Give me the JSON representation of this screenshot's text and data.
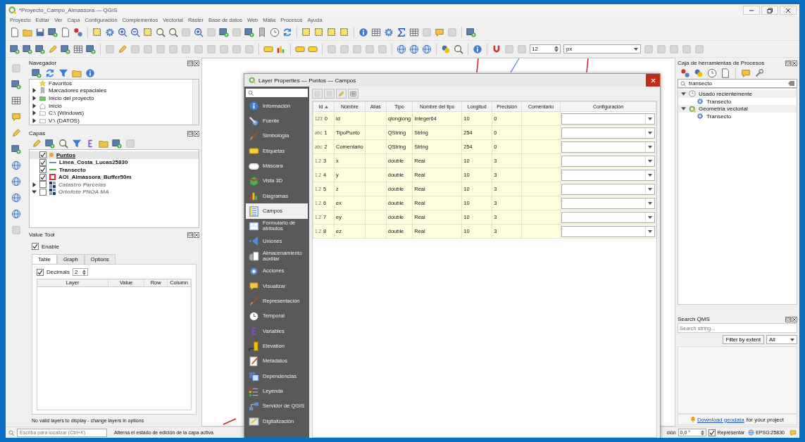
{
  "window": {
    "title": "*Proyecto_Campo_Almassora — QGIS"
  },
  "menu": [
    "Proyecto",
    "Editar",
    "Ver",
    "Capa",
    "Configuración",
    "Complementos",
    "Vectorial",
    "Ráster",
    "Base de datos",
    "Web",
    "Malla",
    "Procesos",
    "Ayuda"
  ],
  "style_toolbar": {
    "size": "12",
    "unit": "px"
  },
  "navigator": {
    "title": "Navegador",
    "items": [
      {
        "label": "Favoritos",
        "kind": "favorites"
      },
      {
        "label": "Marcadores espaciales",
        "kind": "bookmarks",
        "expanded": false
      },
      {
        "label": "Inicio del proyecto",
        "kind": "project",
        "expanded": false
      },
      {
        "label": "Inicio",
        "kind": "home",
        "expanded": false
      },
      {
        "label": "C:\\ (Windows)",
        "kind": "drive",
        "expanded": false
      },
      {
        "label": "V:\\ (DATOS)",
        "kind": "drive",
        "expanded": false
      }
    ]
  },
  "layers": {
    "title": "Capas",
    "items": [
      {
        "label": "Puntos",
        "kind": "point",
        "color": "#f0a030",
        "checked": true,
        "selected": true,
        "dimmed": false
      },
      {
        "label": "Linea_Costa_Lucas25830",
        "kind": "line",
        "color": "#6a8fd0",
        "checked": true,
        "selected": false,
        "dimmed": false
      },
      {
        "label": "Transecto",
        "kind": "line",
        "color": "#4caf50",
        "checked": true,
        "selected": false,
        "dimmed": false
      },
      {
        "label": "AOI_Almassora_Buffer50m",
        "kind": "polygon",
        "color": "#e03030",
        "checked": true,
        "selected": false,
        "dimmed": false
      },
      {
        "label": "Catastro Parcelas",
        "kind": "raster",
        "checked": false,
        "selected": false,
        "dimmed": true,
        "expanded": false
      },
      {
        "label": "Ortofoto PNOA MA",
        "kind": "raster",
        "checked": false,
        "selected": false,
        "dimmed": true,
        "expanded": true
      }
    ]
  },
  "value_tool": {
    "title": "Value Tool",
    "enable": {
      "label": "Enable",
      "checked": true
    },
    "tabs": [
      {
        "label": "Table",
        "selected": true
      },
      {
        "label": "Graph",
        "selected": false
      },
      {
        "label": "Options",
        "selected": false
      }
    ],
    "decimals": {
      "label": "Decimals",
      "checked": true,
      "value": "2"
    },
    "columns": [
      "Layer",
      "Value",
      "Row",
      "Column"
    ],
    "message": "No valid layers to display - change layers in options"
  },
  "dialog": {
    "title": "Layer Properties — Puntos — Campos",
    "sections": [
      {
        "label": "Información",
        "selected": false
      },
      {
        "label": "Fuente",
        "selected": false
      },
      {
        "label": "Simbología",
        "selected": false
      },
      {
        "label": "Etiquetas",
        "selected": false
      },
      {
        "label": "Máscara",
        "selected": false
      },
      {
        "label": "Vista 3D",
        "selected": false
      },
      {
        "label": "Diagramas",
        "selected": false
      },
      {
        "label": "Campos",
        "selected": true
      },
      {
        "label": "Formulario de atributos",
        "selected": false
      },
      {
        "label": "Uniones",
        "selected": false
      },
      {
        "label": "Almacenamiento auxiliar",
        "selected": false
      },
      {
        "label": "Acciones",
        "selected": false
      },
      {
        "label": "Visualizar",
        "selected": false
      },
      {
        "label": "Representación",
        "selected": false
      },
      {
        "label": "Temporal",
        "selected": false
      },
      {
        "label": "Variables",
        "selected": false
      },
      {
        "label": "Elevation",
        "selected": false
      },
      {
        "label": "Metadatos",
        "selected": false
      },
      {
        "label": "Dependencias",
        "selected": false
      },
      {
        "label": "Leyenda",
        "selected": false
      },
      {
        "label": "Servidor de QGIS",
        "selected": false
      },
      {
        "label": "Digitalización",
        "selected": false
      }
    ],
    "table": {
      "columns": [
        "Id",
        "Nombre",
        "Alias",
        "Tipo",
        "Nombre del tipo",
        "Longitud",
        "Precisión",
        "Comentario",
        "Configuración"
      ],
      "rows": [
        {
          "type_icon": "123",
          "index": "0",
          "name": "id",
          "type": "qlonglong",
          "type_name": "Integer64",
          "length": "10",
          "precision": "0"
        },
        {
          "type_icon": "abc",
          "index": "1",
          "name": "TipoPunto",
          "type": "QString",
          "type_name": "String",
          "length": "254",
          "precision": "0"
        },
        {
          "type_icon": "abc",
          "index": "2",
          "name": "Comentario",
          "type": "QString",
          "type_name": "String",
          "length": "254",
          "precision": "0"
        },
        {
          "type_icon": "1.2",
          "index": "3",
          "name": "x",
          "type": "double",
          "type_name": "Real",
          "length": "10",
          "precision": "3"
        },
        {
          "type_icon": "1.2",
          "index": "4",
          "name": "y",
          "type": "double",
          "type_name": "Real",
          "length": "10",
          "precision": "3"
        },
        {
          "type_icon": "1.2",
          "index": "5",
          "name": "z",
          "type": "double",
          "type_name": "Real",
          "length": "10",
          "precision": "3"
        },
        {
          "type_icon": "1.2",
          "index": "6",
          "name": "ex",
          "type": "double",
          "type_name": "Real",
          "length": "10",
          "precision": "3"
        },
        {
          "type_icon": "1.2",
          "index": "7",
          "name": "ey",
          "type": "double",
          "type_name": "Real",
          "length": "10",
          "precision": "3"
        },
        {
          "type_icon": "1.2",
          "index": "8",
          "name": "ez",
          "type": "double",
          "type_name": "Real",
          "length": "10",
          "precision": "3"
        }
      ]
    }
  },
  "processing": {
    "title": "Caja de herramientas de Procesos",
    "search": "transecto",
    "tree": [
      {
        "label": "Usado recientemente",
        "kind": "recent",
        "expanded": true,
        "children": [
          {
            "label": "Transecto",
            "kind": "algorithm"
          }
        ]
      },
      {
        "label": "Geometría vectorial",
        "kind": "provider",
        "expanded": true,
        "children": [
          {
            "label": "Transecto",
            "kind": "algorithm"
          }
        ]
      }
    ]
  },
  "search_qms": {
    "title": "Search QMS",
    "placeholder": "Search string...",
    "filter_button": "Filter by extent",
    "scope": "All",
    "link": "Download geodata",
    "link_suffix": "for your project"
  },
  "status_bar": {
    "locator_placeholder": "Escriba para localizar (Ctrl+K)",
    "message": "Alterna el estado de edición de la capa activa",
    "rotation_label": "ción",
    "rotation": "0,0 °",
    "render": {
      "label": "Representar",
      "checked": true
    },
    "crs": "EPSG:25830"
  }
}
